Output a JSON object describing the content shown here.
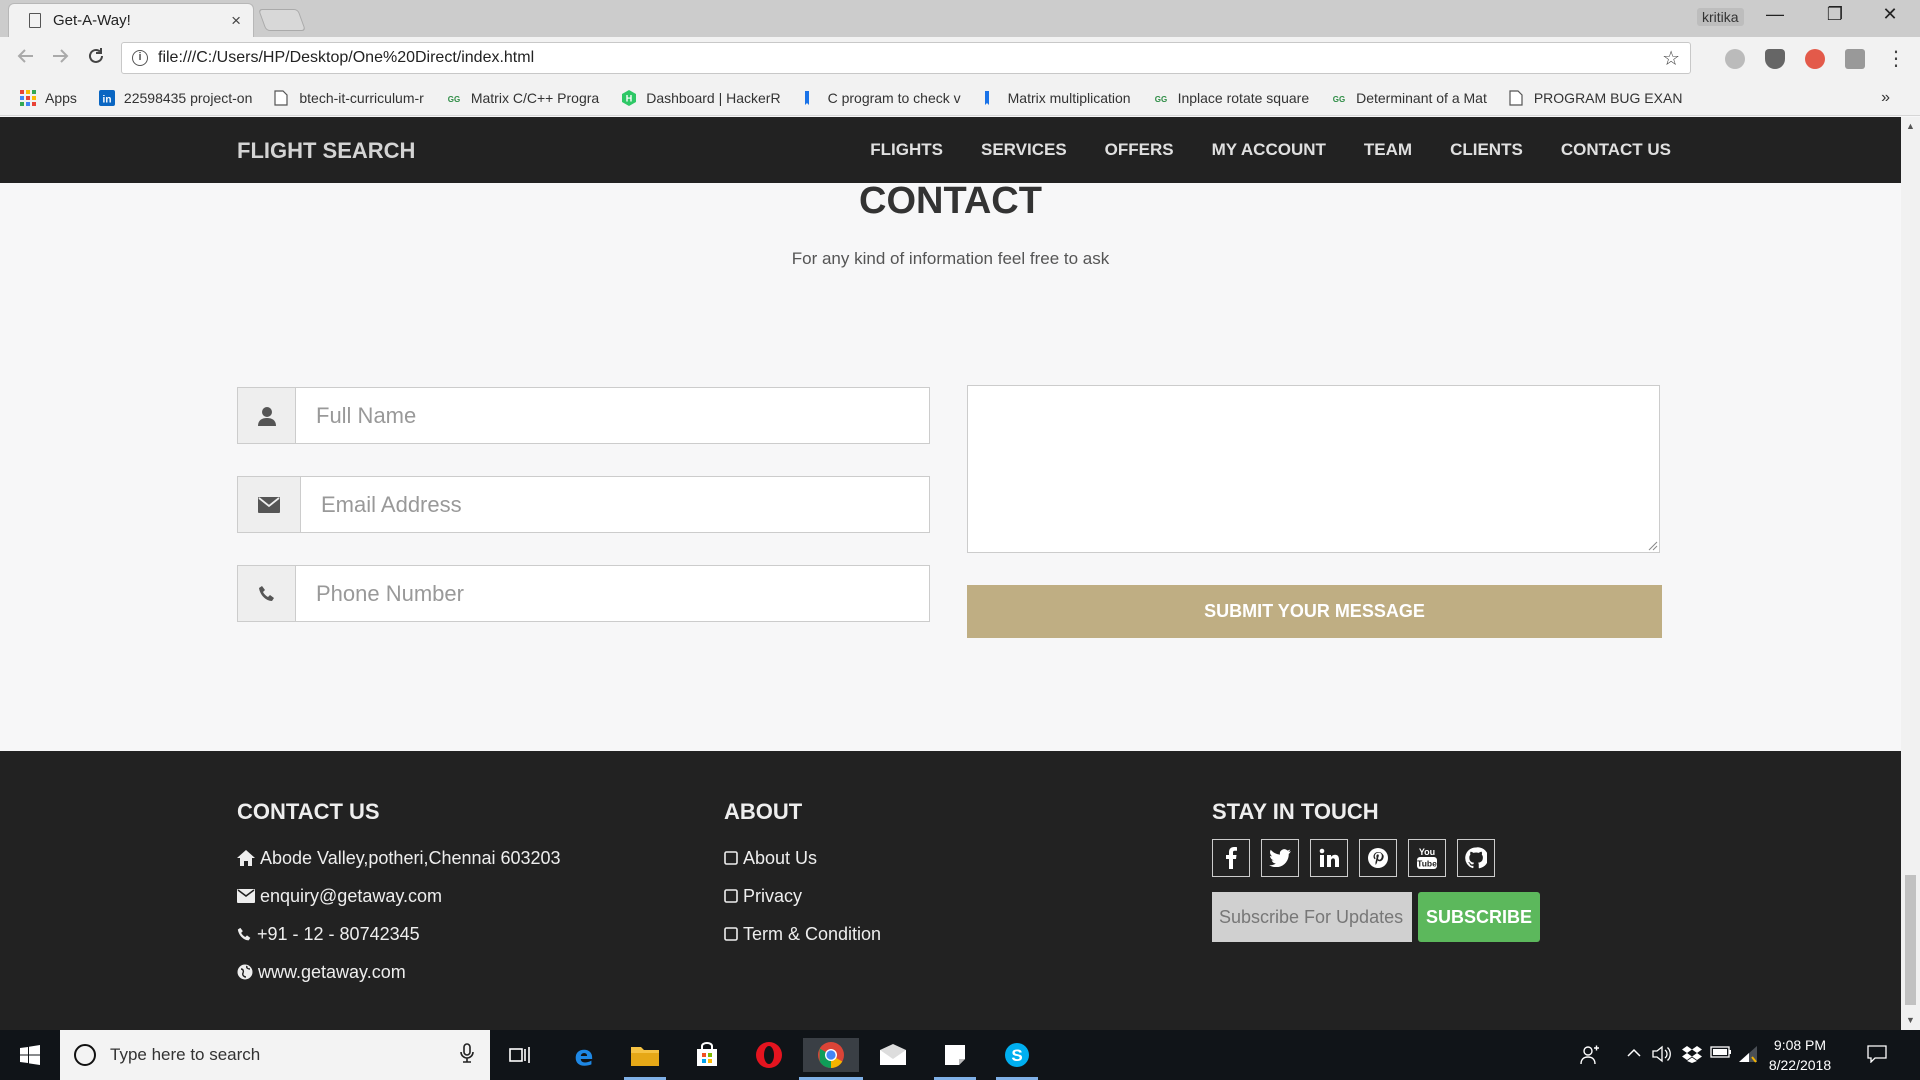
{
  "browser": {
    "tab_title": "Get-A-Way!",
    "tab_close": "×",
    "user": "kritika",
    "url": "file:///C:/Users/HP/Desktop/One%20Direct/index.html",
    "window_controls": {
      "minimize": "—",
      "restore": "❐",
      "close": "✕"
    },
    "bookmarks": [
      {
        "label": "Apps",
        "icon": "apps-grid-icon",
        "color": "#e94235"
      },
      {
        "label": "22598435 project-on",
        "icon": "linkedin-icon",
        "color": "#0a66c2"
      },
      {
        "label": "btech-it-curriculum-r",
        "icon": "page-icon",
        "color": "#666666"
      },
      {
        "label": "Matrix C/C++ Progra",
        "icon": "geeksforgeeks-icon",
        "color": "#2f8d46"
      },
      {
        "label": "Dashboard | HackerR",
        "icon": "hackerrank-icon",
        "color": "#2ec866"
      },
      {
        "label": "C program to check v",
        "icon": "bookmark-flag-icon",
        "color": "#1a73e8"
      },
      {
        "label": "Matrix multiplication",
        "icon": "bookmark-flag-icon",
        "color": "#1a73e8"
      },
      {
        "label": "Inplace rotate square",
        "icon": "geeksforgeeks-icon",
        "color": "#2f8d46"
      },
      {
        "label": "Determinant of a Mat",
        "icon": "geeksforgeeks-icon",
        "color": "#2f8d46"
      },
      {
        "label": "PROGRAM BUG EXAN",
        "icon": "page-icon",
        "color": "#666666"
      }
    ],
    "bookmarks_more": "»"
  },
  "navbar": {
    "brand": "FLIGHT SEARCH",
    "links": [
      "FLIGHTS",
      "SERVICES",
      "OFFERS",
      "MY ACCOUNT",
      "TEAM",
      "CLIENTS",
      "CONTACT US"
    ]
  },
  "contact": {
    "title": "CONTACT",
    "subtitle": "For any kind of information feel free to ask",
    "fields": {
      "name_placeholder": "Full Name",
      "email_placeholder": "Email Address",
      "phone_placeholder": "Phone Number"
    },
    "submit_label": "SUBMIT YOUR MESSAGE",
    "accent": "#bfae83"
  },
  "footer": {
    "contact_heading": "CONTACT US",
    "contact_items": [
      {
        "icon": "home-icon",
        "text": "Abode Valley,potheri,Chennai 603203"
      },
      {
        "icon": "envelope-icon",
        "text": "enquiry@getaway.com"
      },
      {
        "icon": "phone-icon",
        "text": "+91 - 12 - 80742345"
      },
      {
        "icon": "globe-icon",
        "text": "www.getaway.com"
      }
    ],
    "about_heading": "ABOUT",
    "about_items": [
      "About Us",
      "Privacy",
      "Term & Condition"
    ],
    "touch_heading": "STAY IN TOUCH",
    "social": [
      {
        "icon": "facebook-icon",
        "glyph": "f"
      },
      {
        "icon": "twitter-icon",
        "glyph": "🐦"
      },
      {
        "icon": "linkedin-icon",
        "glyph": "in"
      },
      {
        "icon": "pinterest-icon",
        "glyph": "P"
      },
      {
        "icon": "youtube-icon",
        "glyph": "You Tube"
      },
      {
        "icon": "github-icon",
        "glyph": "⌥"
      }
    ],
    "subscribe_placeholder": "Subscribe For Updates",
    "subscribe_label": "SUBSCRIBE",
    "subscribe_color": "#5cb85c"
  },
  "taskbar": {
    "search_placeholder": "Type here to search",
    "time": "9:08 PM",
    "date": "8/22/2018"
  }
}
